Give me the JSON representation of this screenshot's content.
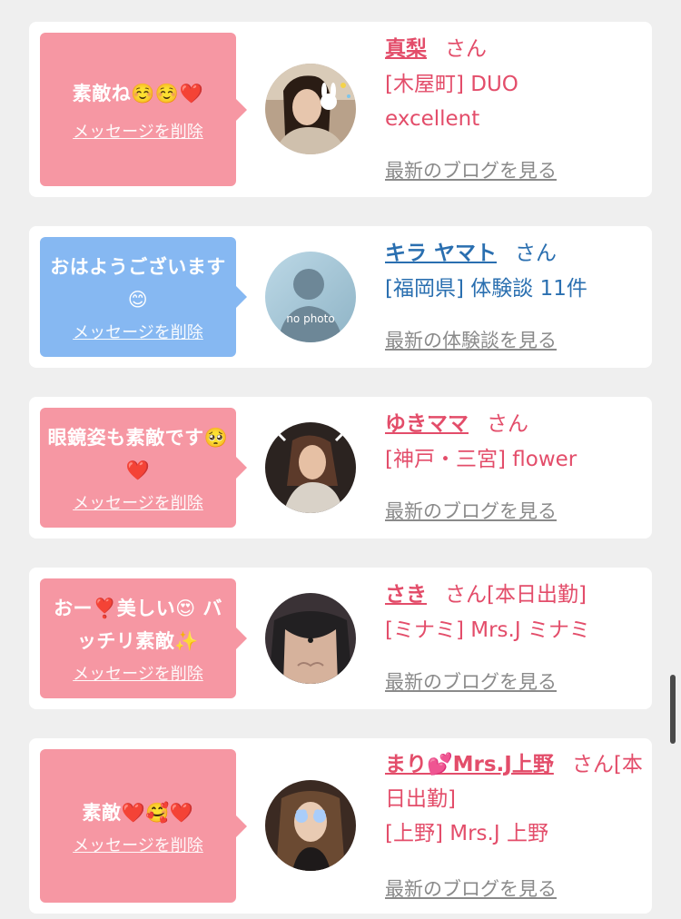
{
  "delete_label": "メッセージを削除",
  "items": [
    {
      "message": "素敵ね☺️☺️❤️",
      "bubble_color": "pink",
      "name": "真梨",
      "suffix": "さん",
      "line1": "[木屋町] DUO",
      "line2": "excellent",
      "more": "最新のブログを見る",
      "avatar": "girl-with-bunny-icon"
    },
    {
      "message": "おはようございます😊",
      "bubble_color": "blue",
      "name": "キラ ヤマト",
      "suffix": "さん",
      "line1": "[福岡県] 体験談 11件",
      "more": "最新の体験談を見る",
      "avatar": "no-photo-silhouette",
      "avatar_text": "no photo"
    },
    {
      "message": "眼鏡姿も素敵です🥺❤️",
      "bubble_color": "pink",
      "name": "ゆきママ",
      "suffix": "さん",
      "line1": "[神戸・三宮] flower",
      "more": "最新のブログを見る",
      "avatar": "woman-photo"
    },
    {
      "message": "おー❣️美しい😍 バッチリ素敵✨",
      "bubble_color": "pink",
      "name": "さき",
      "suffix": "さん[本日出勤]",
      "line1": "[ミナミ] Mrs.J ミナミ",
      "more": "最新のブログを見る",
      "avatar": "woman-photo-dark"
    },
    {
      "message": "素敵❤️🥰❤️",
      "bubble_color": "pink",
      "name": "まり💕Mrs.J上野",
      "suffix": "さん[本日出勤]",
      "line1": "[上野] Mrs.J 上野",
      "more": "最新のブログを見る",
      "avatar": "woman-with-heart-sunglasses"
    }
  ],
  "colors": {
    "pink_bubble": "#f697a3",
    "blue_bubble": "#86b8f2",
    "pink_text": "#e34d6a",
    "blue_text": "#2a6fb0"
  }
}
